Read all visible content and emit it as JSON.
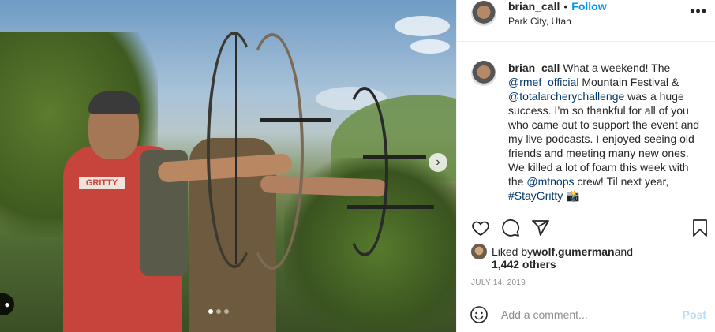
{
  "post": {
    "username": "brian_call",
    "separator": "•",
    "follow_label": "Follow",
    "location": "Park City, Utah",
    "more_label": "•••",
    "photo": {
      "shirt_text": "GRITTY",
      "next_arrow": "›",
      "tag_glyph": "●",
      "slide_count": 3,
      "active_slide": 1
    },
    "caption": {
      "username": "brian_call",
      "t1": "What a weekend! The ",
      "m1": "@rmef_official",
      "t2": " Mountain Festival & ",
      "m2": "@totalarcherychallenge",
      "t3": " was a huge success. I’m so thankful for all of you who came out to support the event and my live podcasts. I enjoyed seeing old friends and meeting many new ones. We killed a lot of foam this week with the ",
      "m3": "@mtnops",
      "t4": " crew! Til next year, ",
      "h1": "#StayGritty",
      "emoji": " 📸"
    },
    "likes": {
      "prefix": "Liked by ",
      "user": "wolf.gumerman",
      "and": " and",
      "others": "1,442 others"
    },
    "date": "JULY 14, 2019",
    "comment": {
      "placeholder": "Add a comment...",
      "post_label": "Post"
    },
    "icons": [
      "heart-icon",
      "comment-icon",
      "share-icon",
      "bookmark-icon",
      "emoji-icon"
    ]
  }
}
